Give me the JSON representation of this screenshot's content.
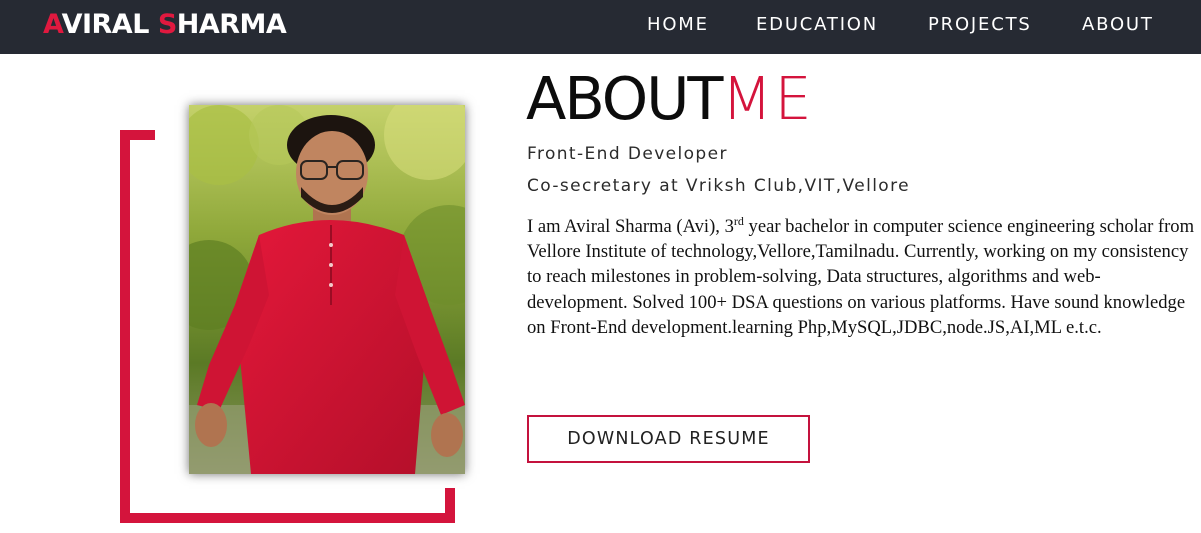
{
  "navbar": {
    "logo": {
      "first_initial": "A",
      "first_rest": "VIRAL ",
      "last_initial": "S",
      "last_rest": "HARMA"
    },
    "links": [
      "HOME",
      "EDUCATION",
      "PROJECTS",
      "ABOUT"
    ]
  },
  "about": {
    "heading_dark": "ABOUT",
    "heading_accent": "ME",
    "role": "Front-End Developer",
    "position": "Co-secretary at Vriksh Club,VIT,Vellore",
    "bio_part1": "I am Aviral Sharma (Avi), 3",
    "bio_sup": "rd",
    "bio_part2": " year bachelor in computer science engineering scholar from Vellore Institute of technology,Vellore,Tamilnadu. Currently, working on my consistency to reach milestones in problem-solving, Data structures, algorithms and web-development. Solved 100+ DSA questions on various platforms. Have sound knowledge on Front-End development.learning Php,MySQL,JDBC,node.JS,AI,ML e.t.c.",
    "resume_button": "DOWNLOAD RESUME"
  },
  "colors": {
    "accent": "#d4143c",
    "navbar_bg": "#262a33"
  }
}
